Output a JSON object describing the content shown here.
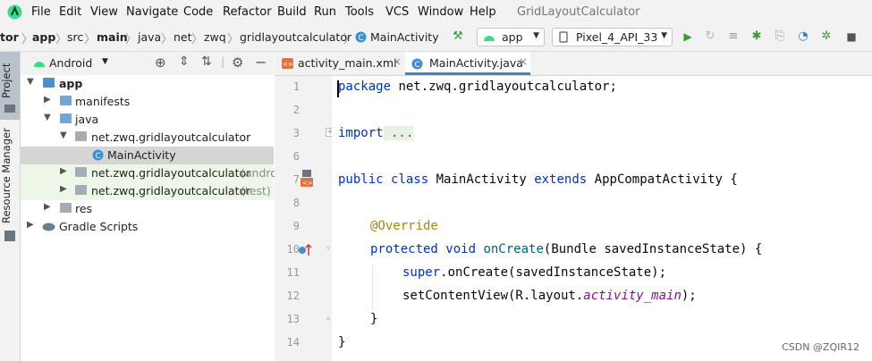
{
  "menubar": {
    "items": [
      "File",
      "Edit",
      "View",
      "Navigate",
      "Code",
      "Refactor",
      "Build",
      "Run",
      "Tools",
      "VCS",
      "Window",
      "Help"
    ],
    "window_title": "GridLayoutCalculator"
  },
  "navbar": {
    "crumbs": [
      "tor",
      "app",
      "src",
      "main",
      "java",
      "net",
      "zwq",
      "gridlayoutcalculator",
      "MainActivity"
    ],
    "run_config": "app",
    "device": "Pixel_4_API_33"
  },
  "strip": {
    "project_label": "Project",
    "resource_label": "Resource Manager"
  },
  "project_panel": {
    "view_mode": "Android",
    "tree": [
      {
        "label": "app",
        "bold": true
      },
      {
        "label": "manifests"
      },
      {
        "label": "java"
      },
      {
        "label": "net.zwq.gridlayoutcalculator"
      },
      {
        "label": "MainActivity",
        "selected": true
      },
      {
        "label": "net.zwq.gridlayoutcalculator",
        "suffix": "(andro"
      },
      {
        "label": "net.zwq.gridlayoutcalculator",
        "suffix": "(test)"
      },
      {
        "label": "res"
      },
      {
        "label": "Gradle Scripts"
      }
    ]
  },
  "editor": {
    "tabs": [
      {
        "label": "activity_main.xml",
        "active": false
      },
      {
        "label": "MainActivity.java",
        "active": true
      }
    ],
    "line_numbers": [
      "1",
      "2",
      "3",
      "6",
      "7",
      "8",
      "9",
      "10",
      "11",
      "12",
      "13",
      "14"
    ],
    "code": {
      "l1_kw": "package",
      "l1_rest": " net.zwq.gridlayoutcalculator;",
      "l3_kw": "import",
      "l3_fold": " ...",
      "l7_kw1": "public",
      "l7_kw2": "class",
      "l7_name": "MainActivity",
      "l7_kw3": "extends",
      "l7_rest": "AppCompatActivity {",
      "l9_ann": "@Override",
      "l10_kw1": "protected",
      "l10_kw2": "void",
      "l10_fn": "onCreate",
      "l10_rest": "(Bundle savedInstanceState) {",
      "l11_kw": "super",
      "l11_rest": ".onCreate(savedInstanceState);",
      "l12_a": "setContentView(R.layout.",
      "l12_it": "activity_main",
      "l12_b": ");",
      "l13": "}",
      "l14": "}"
    }
  },
  "watermark": "CSDN @ZQIR12",
  "colors": {
    "keyword": "#0033b3",
    "annotation": "#9e880d",
    "field": "#871094",
    "selection": "#d5d5d5"
  }
}
